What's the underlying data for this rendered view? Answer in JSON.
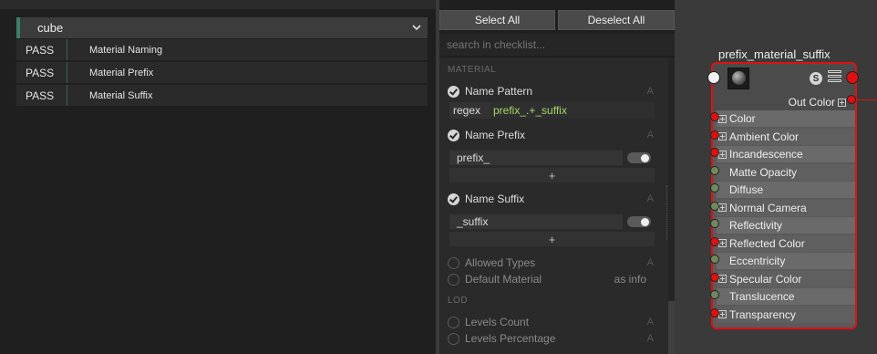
{
  "validator": {
    "asset": "cube",
    "results": [
      {
        "status": "PASS",
        "name": "Material Naming"
      },
      {
        "status": "PASS",
        "name": "Material Prefix"
      },
      {
        "status": "PASS",
        "name": "Material Suffix"
      }
    ]
  },
  "checklist": {
    "select_all": "Select All",
    "deselect_all": "Deselect All",
    "search_placeholder": "search in checklist...",
    "section_material": "MATERIAL",
    "name_pattern": {
      "label": "Name Pattern",
      "badge": "A",
      "field_label": "regex",
      "field_value": "prefix_.+_suffix"
    },
    "name_prefix": {
      "label": "Name Prefix",
      "badge": "A",
      "value": "prefix_",
      "add": "+"
    },
    "name_suffix": {
      "label": "Name Suffix",
      "badge": "A",
      "value": "_suffix",
      "add": "+"
    },
    "allowed_types": {
      "label": "Allowed Types",
      "badge": "A"
    },
    "default_material": {
      "label": "Default Material",
      "note": "as info"
    },
    "section_lod": "LOD",
    "levels_count": {
      "label": "Levels Count",
      "badge": "A"
    },
    "levels_percentage": {
      "label": "Levels Percentage",
      "badge": "A"
    }
  },
  "node": {
    "title": "prefix_material_suffix",
    "s_badge": "S",
    "out_color": "Out Color",
    "attributes": [
      {
        "label": "Color",
        "expandable": true,
        "port": "red"
      },
      {
        "label": "Ambient Color",
        "expandable": true,
        "port": "red"
      },
      {
        "label": "Incandescence",
        "expandable": true,
        "port": "red"
      },
      {
        "label": "Matte Opacity",
        "expandable": false,
        "port": "green"
      },
      {
        "label": "Diffuse",
        "expandable": false,
        "port": "green"
      },
      {
        "label": "Normal Camera",
        "expandable": true,
        "port": "green"
      },
      {
        "label": "Reflectivity",
        "expandable": false,
        "port": "green"
      },
      {
        "label": "Reflected Color",
        "expandable": true,
        "port": "red"
      },
      {
        "label": "Eccentricity",
        "expandable": false,
        "port": "green"
      },
      {
        "label": "Specular Color",
        "expandable": true,
        "port": "red"
      },
      {
        "label": "Translucence",
        "expandable": false,
        "port": "green"
      },
      {
        "label": "Transparency",
        "expandable": true,
        "port": "red"
      }
    ]
  },
  "colors": {
    "accent": "#3b7f6a",
    "node_border": "#e01010",
    "regex_text": "#a8d86a"
  }
}
